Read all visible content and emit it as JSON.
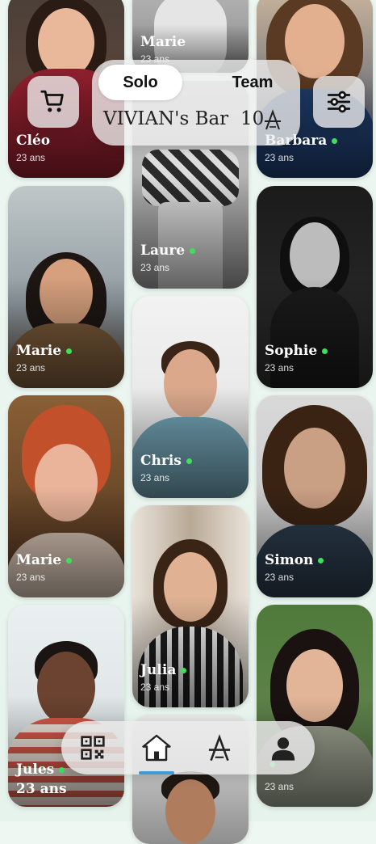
{
  "header": {
    "tabs": [
      {
        "label": "Solo",
        "active": true
      },
      {
        "label": "Team",
        "active": false
      }
    ],
    "venue_name": "VIVIAN's Bar",
    "table_number": "10",
    "cart_icon": "cart-icon",
    "filter_icon": "sliders-icon"
  },
  "profiles": {
    "left": [
      {
        "name": "Cléo",
        "age": "23 ans",
        "online": false
      },
      {
        "name": "Marie",
        "age": "23 ans",
        "online": true
      },
      {
        "name": "Marie",
        "age": "23 ans",
        "online": true
      },
      {
        "name": "Jules",
        "age": "23 ans",
        "online": true
      }
    ],
    "middle": [
      {
        "name": "Marie",
        "age": "23 ans",
        "online": false
      },
      {
        "name": "Laure",
        "age": "23 ans",
        "online": true
      },
      {
        "name": "Chris",
        "age": "23 ans",
        "online": true
      },
      {
        "name": "Julia",
        "age": "23 ans",
        "online": true
      }
    ],
    "right": [
      {
        "name": "Barbara",
        "age": "23 ans",
        "online": true
      },
      {
        "name": "Sophie",
        "age": "23 ans",
        "online": true
      },
      {
        "name": "Simon",
        "age": "23 ans",
        "online": true
      },
      {
        "name": "",
        "age": "23 ans",
        "online": true
      }
    ]
  },
  "bottom_nav": {
    "items": [
      {
        "icon": "qr-code-icon",
        "active": false
      },
      {
        "icon": "home-icon",
        "active": true
      },
      {
        "icon": "table-icon",
        "active": false
      },
      {
        "icon": "profile-icon",
        "active": false
      }
    ]
  },
  "colors": {
    "online_dot": "#3ee05a",
    "active_indicator": "#3d9bd8"
  }
}
